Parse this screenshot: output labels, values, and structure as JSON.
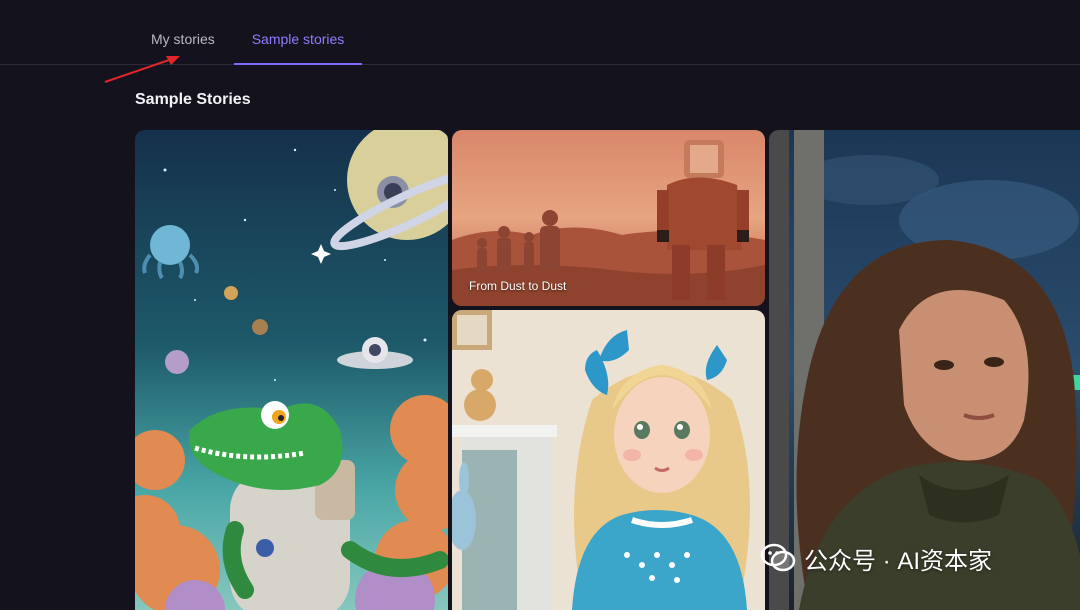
{
  "tabs": [
    {
      "label": "My stories",
      "active": false
    },
    {
      "label": "Sample stories",
      "active": true
    }
  ],
  "section": {
    "title": "Sample Stories"
  },
  "stories": [
    {
      "caption": "",
      "scene": "space crocodile astronaut"
    },
    {
      "caption": "From Dust to Dust",
      "scene": "astronauts on mars"
    },
    {
      "caption": "",
      "scene": "blonde girl with blue bow"
    },
    {
      "caption": "",
      "scene": "woman in night street"
    }
  ],
  "watermark": {
    "text": "公众号 · AI资本家"
  },
  "colors": {
    "background": "#14131d",
    "accent": "#7b6bff",
    "annotation_arrow": "#e0262a"
  }
}
